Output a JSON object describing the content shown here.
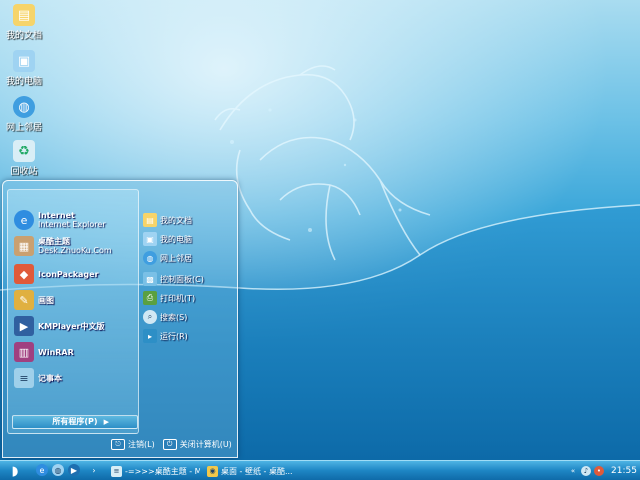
{
  "desktop_icons": [
    {
      "label": "我的文档",
      "icon": "folder-documents-icon",
      "color": "#f6d46a"
    },
    {
      "label": "我的电脑",
      "icon": "computer-icon",
      "color": "#9fd3f2"
    },
    {
      "label": "网上邻居",
      "icon": "network-icon",
      "color": "#3f9ee0"
    },
    {
      "label": "回收站",
      "icon": "recycle-bin-icon",
      "color": "#d9eef6"
    }
  ],
  "start_menu": {
    "pinned": [
      {
        "title": "Internet",
        "subtitle": "Internet Explorer",
        "icon": "internet-explorer-icon",
        "color": "#2f8de0"
      },
      {
        "title": "桌酷主题",
        "subtitle": "Desk.ZhuoKu.Com",
        "icon": "zhuoku-icon",
        "color": "#c9a070"
      },
      {
        "title": "IconPackager",
        "subtitle": "",
        "icon": "iconpackager-icon",
        "color": "#e05a3a"
      },
      {
        "title": "画图",
        "subtitle": "",
        "icon": "paint-icon",
        "color": "#e0b040"
      },
      {
        "title": "KMPlayer中文版",
        "subtitle": "",
        "icon": "kmplayer-icon",
        "color": "#3060a0"
      },
      {
        "title": "WinRAR",
        "subtitle": "",
        "icon": "winrar-icon",
        "color": "#a04080"
      },
      {
        "title": "记事本",
        "subtitle": "",
        "icon": "notepad-icon",
        "color": "#9fd0ea"
      }
    ],
    "all_programs": "所有程序(P)",
    "places": [
      {
        "label": "我的文档",
        "icon": "folder-documents-icon",
        "color": "#f6d46a"
      },
      {
        "label": "我的电脑",
        "icon": "computer-icon",
        "color": "#9fd3f2"
      },
      {
        "label": "网上邻居",
        "icon": "network-icon",
        "color": "#3f9ee0"
      },
      {
        "label": "控制面板(C)",
        "icon": "control-panel-icon",
        "color": "#7ac0e6"
      },
      {
        "label": "打印机(T)",
        "icon": "printer-icon",
        "color": "#5aa040"
      },
      {
        "label": "搜索(S)",
        "icon": "search-icon",
        "color": "#d0e8f4"
      },
      {
        "label": "运行(R)",
        "icon": "run-icon",
        "color": "#2d8fc6"
      }
    ],
    "logoff": "注销(L)",
    "shutdown": "关闭计算机(U)"
  },
  "taskbar": {
    "tasks": [
      {
        "label": "-=>>>桌酷主题 - Mi...",
        "icon": "browser-icon",
        "color": "#d9eef6"
      },
      {
        "label": "桌面 - 壁纸 - 桌酷...",
        "icon": "browser-icon",
        "color": "#f2c84a"
      }
    ],
    "clock": "21:55"
  }
}
